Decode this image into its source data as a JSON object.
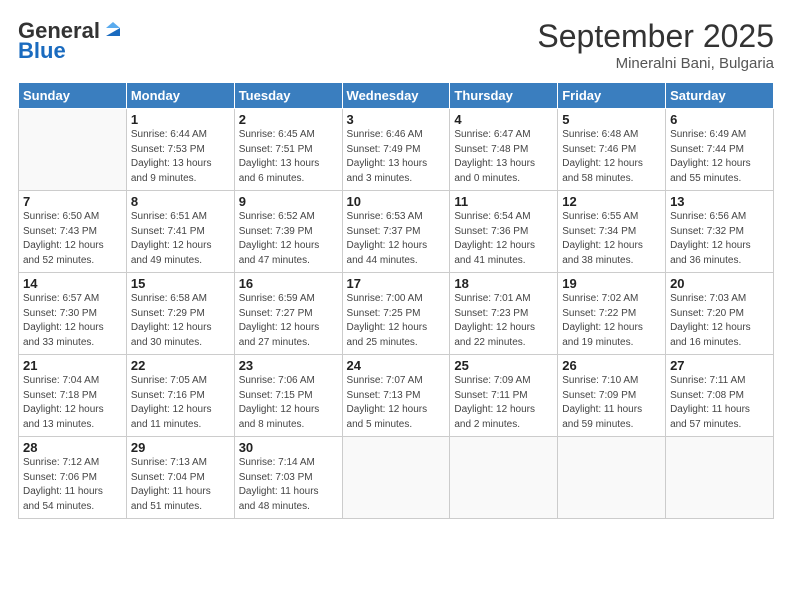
{
  "logo": {
    "line1": "General",
    "line2": "Blue"
  },
  "title": "September 2025",
  "subtitle": "Mineralni Bani, Bulgaria",
  "days_of_week": [
    "Sunday",
    "Monday",
    "Tuesday",
    "Wednesday",
    "Thursday",
    "Friday",
    "Saturday"
  ],
  "weeks": [
    [
      {
        "num": "",
        "info": ""
      },
      {
        "num": "1",
        "info": "Sunrise: 6:44 AM\nSunset: 7:53 PM\nDaylight: 13 hours\nand 9 minutes."
      },
      {
        "num": "2",
        "info": "Sunrise: 6:45 AM\nSunset: 7:51 PM\nDaylight: 13 hours\nand 6 minutes."
      },
      {
        "num": "3",
        "info": "Sunrise: 6:46 AM\nSunset: 7:49 PM\nDaylight: 13 hours\nand 3 minutes."
      },
      {
        "num": "4",
        "info": "Sunrise: 6:47 AM\nSunset: 7:48 PM\nDaylight: 13 hours\nand 0 minutes."
      },
      {
        "num": "5",
        "info": "Sunrise: 6:48 AM\nSunset: 7:46 PM\nDaylight: 12 hours\nand 58 minutes."
      },
      {
        "num": "6",
        "info": "Sunrise: 6:49 AM\nSunset: 7:44 PM\nDaylight: 12 hours\nand 55 minutes."
      }
    ],
    [
      {
        "num": "7",
        "info": "Sunrise: 6:50 AM\nSunset: 7:43 PM\nDaylight: 12 hours\nand 52 minutes."
      },
      {
        "num": "8",
        "info": "Sunrise: 6:51 AM\nSunset: 7:41 PM\nDaylight: 12 hours\nand 49 minutes."
      },
      {
        "num": "9",
        "info": "Sunrise: 6:52 AM\nSunset: 7:39 PM\nDaylight: 12 hours\nand 47 minutes."
      },
      {
        "num": "10",
        "info": "Sunrise: 6:53 AM\nSunset: 7:37 PM\nDaylight: 12 hours\nand 44 minutes."
      },
      {
        "num": "11",
        "info": "Sunrise: 6:54 AM\nSunset: 7:36 PM\nDaylight: 12 hours\nand 41 minutes."
      },
      {
        "num": "12",
        "info": "Sunrise: 6:55 AM\nSunset: 7:34 PM\nDaylight: 12 hours\nand 38 minutes."
      },
      {
        "num": "13",
        "info": "Sunrise: 6:56 AM\nSunset: 7:32 PM\nDaylight: 12 hours\nand 36 minutes."
      }
    ],
    [
      {
        "num": "14",
        "info": "Sunrise: 6:57 AM\nSunset: 7:30 PM\nDaylight: 12 hours\nand 33 minutes."
      },
      {
        "num": "15",
        "info": "Sunrise: 6:58 AM\nSunset: 7:29 PM\nDaylight: 12 hours\nand 30 minutes."
      },
      {
        "num": "16",
        "info": "Sunrise: 6:59 AM\nSunset: 7:27 PM\nDaylight: 12 hours\nand 27 minutes."
      },
      {
        "num": "17",
        "info": "Sunrise: 7:00 AM\nSunset: 7:25 PM\nDaylight: 12 hours\nand 25 minutes."
      },
      {
        "num": "18",
        "info": "Sunrise: 7:01 AM\nSunset: 7:23 PM\nDaylight: 12 hours\nand 22 minutes."
      },
      {
        "num": "19",
        "info": "Sunrise: 7:02 AM\nSunset: 7:22 PM\nDaylight: 12 hours\nand 19 minutes."
      },
      {
        "num": "20",
        "info": "Sunrise: 7:03 AM\nSunset: 7:20 PM\nDaylight: 12 hours\nand 16 minutes."
      }
    ],
    [
      {
        "num": "21",
        "info": "Sunrise: 7:04 AM\nSunset: 7:18 PM\nDaylight: 12 hours\nand 13 minutes."
      },
      {
        "num": "22",
        "info": "Sunrise: 7:05 AM\nSunset: 7:16 PM\nDaylight: 12 hours\nand 11 minutes."
      },
      {
        "num": "23",
        "info": "Sunrise: 7:06 AM\nSunset: 7:15 PM\nDaylight: 12 hours\nand 8 minutes."
      },
      {
        "num": "24",
        "info": "Sunrise: 7:07 AM\nSunset: 7:13 PM\nDaylight: 12 hours\nand 5 minutes."
      },
      {
        "num": "25",
        "info": "Sunrise: 7:09 AM\nSunset: 7:11 PM\nDaylight: 12 hours\nand 2 minutes."
      },
      {
        "num": "26",
        "info": "Sunrise: 7:10 AM\nSunset: 7:09 PM\nDaylight: 11 hours\nand 59 minutes."
      },
      {
        "num": "27",
        "info": "Sunrise: 7:11 AM\nSunset: 7:08 PM\nDaylight: 11 hours\nand 57 minutes."
      }
    ],
    [
      {
        "num": "28",
        "info": "Sunrise: 7:12 AM\nSunset: 7:06 PM\nDaylight: 11 hours\nand 54 minutes."
      },
      {
        "num": "29",
        "info": "Sunrise: 7:13 AM\nSunset: 7:04 PM\nDaylight: 11 hours\nand 51 minutes."
      },
      {
        "num": "30",
        "info": "Sunrise: 7:14 AM\nSunset: 7:03 PM\nDaylight: 11 hours\nand 48 minutes."
      },
      {
        "num": "",
        "info": ""
      },
      {
        "num": "",
        "info": ""
      },
      {
        "num": "",
        "info": ""
      },
      {
        "num": "",
        "info": ""
      }
    ]
  ]
}
